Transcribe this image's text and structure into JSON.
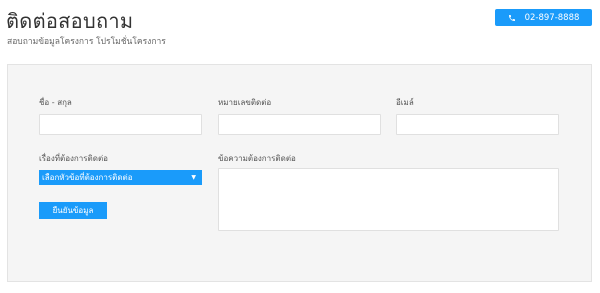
{
  "header": {
    "title": "ติดต่อสอบถาม",
    "subtitle": "สอบถามข้อมูลโครงการ โปรโมชั่นโครงการ",
    "phone": "02-897-8888"
  },
  "form": {
    "name_label": "ชื่อ - สกุล",
    "phone_label": "หมายเลขติดต่อ",
    "email_label": "อีเมล์",
    "topic_label": "เรื่องที่ต้องการติดต่อ",
    "topic_selected": "เลือกหัวข้อที่ต้องการติดต่อ",
    "message_label": "ข้อความต้องการติดต่อ",
    "submit_label": "ยืนยันข้อมูล"
  },
  "icons": {
    "phone": "phone-icon",
    "dropdown": "caret-down-icon"
  },
  "colors": {
    "accent": "#1a9bfa",
    "panel_bg": "#f5f5f5"
  }
}
